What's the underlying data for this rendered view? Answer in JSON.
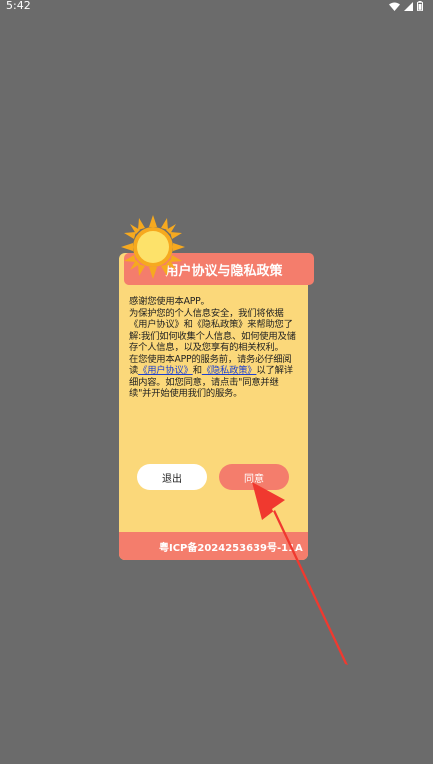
{
  "status_bar": {
    "time": "5:42"
  },
  "dialog": {
    "title": "用户协议与隐私政策",
    "body": {
      "line1": "感谢您使用本APP。",
      "para2": "为保护您的个人信息安全，我们将依据《用户协议》和《隐私政策》来帮助您了解:我们如何收集个人信息、如何使用及储存个人信息，以及您享有的相关权利。",
      "para3_prefix": "在您使用本APP的服务前，请务必仔细阅读",
      "link_user_agreement": "《用户协议》",
      "para3_and": "和",
      "link_privacy_policy": "《隐私政策》",
      "para3_suffix": "以了解详细内容。如您同意，请点击\"同意并继续\"并开始使用我们的服务。"
    },
    "exit_button": "退出",
    "agree_button": "同意",
    "footer": "粤ICP备2024253639号-11A"
  },
  "colors": {
    "background": "#6b6b6b",
    "dialog": "#fbd87a",
    "accent": "#f47d6c",
    "arrow": "#f0392f"
  }
}
